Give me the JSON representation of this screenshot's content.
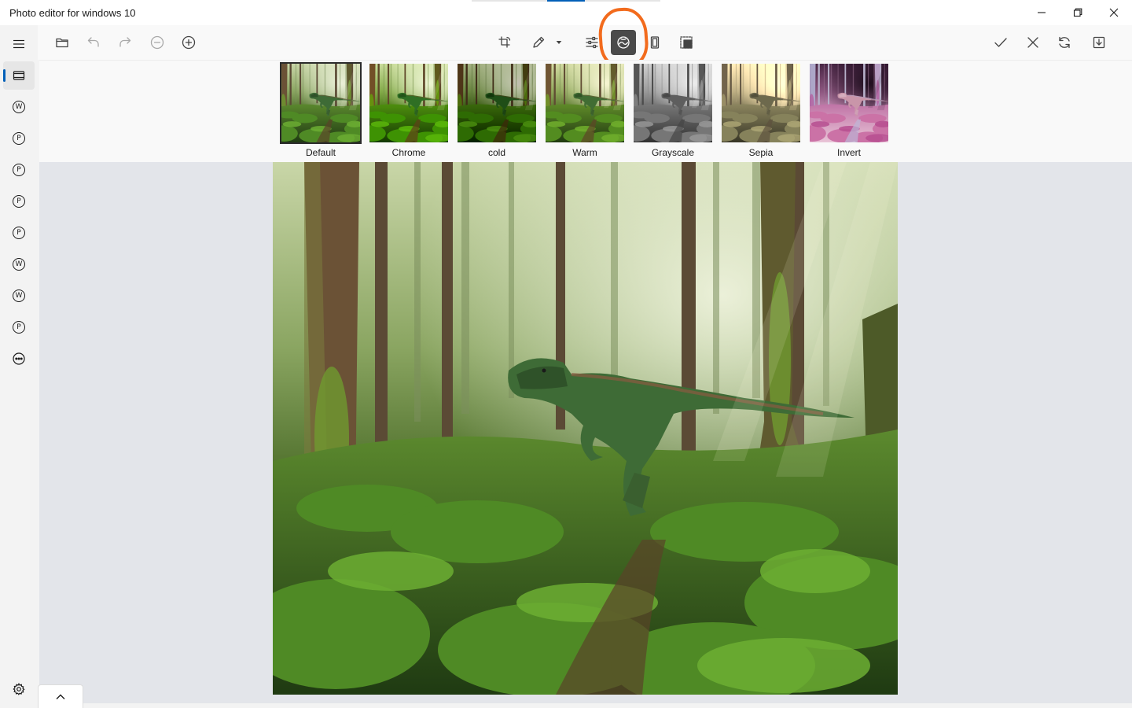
{
  "window": {
    "title": "Photo editor for windows 10"
  },
  "sidebar": {
    "items": [
      {
        "name": "sidebar-item-filmstrip",
        "glyph": ""
      },
      {
        "name": "sidebar-item-w1",
        "glyph": "W"
      },
      {
        "name": "sidebar-item-p1",
        "glyph": "P"
      },
      {
        "name": "sidebar-item-p2",
        "glyph": "P"
      },
      {
        "name": "sidebar-item-p3",
        "glyph": "P"
      },
      {
        "name": "sidebar-item-p4",
        "glyph": "P"
      },
      {
        "name": "sidebar-item-w2",
        "glyph": "W"
      },
      {
        "name": "sidebar-item-w3",
        "glyph": "W"
      },
      {
        "name": "sidebar-item-p5",
        "glyph": "P"
      }
    ]
  },
  "toolbar": {
    "left": [
      "open-folder-icon",
      "undo-icon",
      "redo-icon",
      "zoom-out-icon",
      "zoom-in-icon"
    ],
    "center": [
      "crop-rotate-icon",
      "draw-pen-icon",
      "dropdown-icon",
      "adjust-sliders-icon",
      "filters-icon",
      "frame-icon",
      "resize-icon"
    ],
    "right": [
      "apply-check-icon",
      "cancel-x-icon",
      "reset-icon",
      "save-icon"
    ],
    "active_tool": "filters-icon"
  },
  "filters": [
    {
      "label": "Default",
      "style": "default"
    },
    {
      "label": "Chrome",
      "style": "chrome"
    },
    {
      "label": "cold",
      "style": "cold"
    },
    {
      "label": "Warm",
      "style": "warm"
    },
    {
      "label": "Grayscale",
      "style": "grayscale"
    },
    {
      "label": "Sepia",
      "style": "sepia"
    },
    {
      "label": "Invert",
      "style": "invert"
    }
  ],
  "selected_filter": "Default",
  "colors": {
    "accent": "#005fb8",
    "highlight_ring": "#f26b1d",
    "active_tool_bg": "#4a4a4a",
    "canvas_bg": "#e3e5ea"
  }
}
